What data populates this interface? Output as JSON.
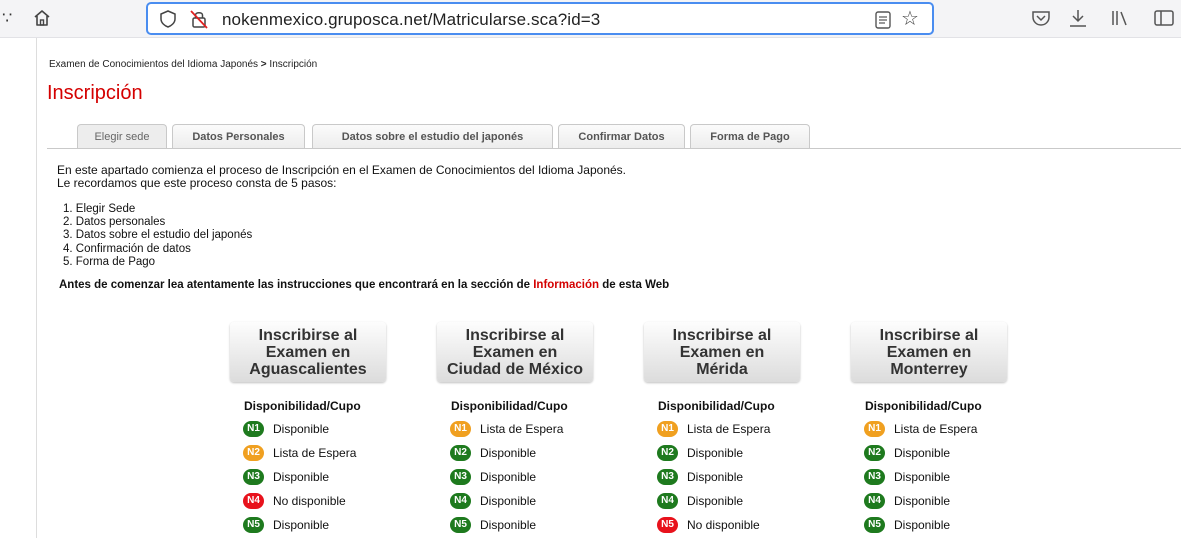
{
  "browser": {
    "url": "nokenmexico.gruposca.net/Matricularse.sca?id=3",
    "edge_glyph": "∵",
    "star_glyph": "☆",
    "icons": [
      "home-icon",
      "shield-icon",
      "lock-slash-icon",
      "reader-icon",
      "star-icon",
      "pocket-icon",
      "download-icon",
      "library-icon",
      "sidebar-icon"
    ]
  },
  "breadcrumb": {
    "parent": "Examen de Conocimientos del Idioma Japonés",
    "separator": ">",
    "current": "Inscripción"
  },
  "page_title": "Inscripción",
  "tabs": [
    {
      "label": "Elegir sede"
    },
    {
      "label": "Datos Personales"
    },
    {
      "label": "Datos sobre el estudio del japonés"
    },
    {
      "label": "Confirmar Datos"
    },
    {
      "label": "Forma de Pago"
    }
  ],
  "intro": {
    "line1": "En este apartado comienza el proceso de Inscripción en el Examen de Conocimientos del Idioma Japonés.",
    "line2": "Le recordamos que este proceso consta de 5 pasos:"
  },
  "steps": [
    "1. Elegir Sede",
    "2. Datos personales",
    "3. Datos sobre el estudio del japonés",
    "4. Confirmación de datos",
    "5. Forma de Pago"
  ],
  "notice": {
    "before": "Antes de comenzar lea atentamente las instrucciones que encontrará en la sección de ",
    "link": "Información",
    "after": " de esta Web"
  },
  "availability_header": "Disponibilidad/Cupo",
  "status_colors": {
    "Disponible": "#1e7a1e",
    "Lista de Espera": "#f0a020",
    "No disponible": "#e8121c"
  },
  "venues": [
    {
      "line1": "Inscribirse al",
      "line2": "Examen en",
      "line3": "Aguascalientes",
      "levels": [
        {
          "level": "N1",
          "status": "Disponible"
        },
        {
          "level": "N2",
          "status": "Lista de Espera"
        },
        {
          "level": "N3",
          "status": "Disponible"
        },
        {
          "level": "N4",
          "status": "No disponible"
        },
        {
          "level": "N5",
          "status": "Disponible"
        }
      ]
    },
    {
      "line1": "Inscribirse al",
      "line2": "Examen en",
      "line3": "Ciudad de México",
      "levels": [
        {
          "level": "N1",
          "status": "Lista de Espera"
        },
        {
          "level": "N2",
          "status": "Disponible"
        },
        {
          "level": "N3",
          "status": "Disponible"
        },
        {
          "level": "N4",
          "status": "Disponible"
        },
        {
          "level": "N5",
          "status": "Disponible"
        }
      ]
    },
    {
      "line1": "Inscribirse al",
      "line2": "Examen en",
      "line3": "Mérida",
      "levels": [
        {
          "level": "N1",
          "status": "Lista de Espera"
        },
        {
          "level": "N2",
          "status": "Disponible"
        },
        {
          "level": "N3",
          "status": "Disponible"
        },
        {
          "level": "N4",
          "status": "Disponible"
        },
        {
          "level": "N5",
          "status": "No disponible"
        }
      ]
    },
    {
      "line1": "Inscribirse al",
      "line2": "Examen en",
      "line3": "Monterrey",
      "levels": [
        {
          "level": "N1",
          "status": "Lista de Espera"
        },
        {
          "level": "N2",
          "status": "Disponible"
        },
        {
          "level": "N3",
          "status": "Disponible"
        },
        {
          "level": "N4",
          "status": "Disponible"
        },
        {
          "level": "N5",
          "status": "Disponible"
        }
      ]
    }
  ]
}
